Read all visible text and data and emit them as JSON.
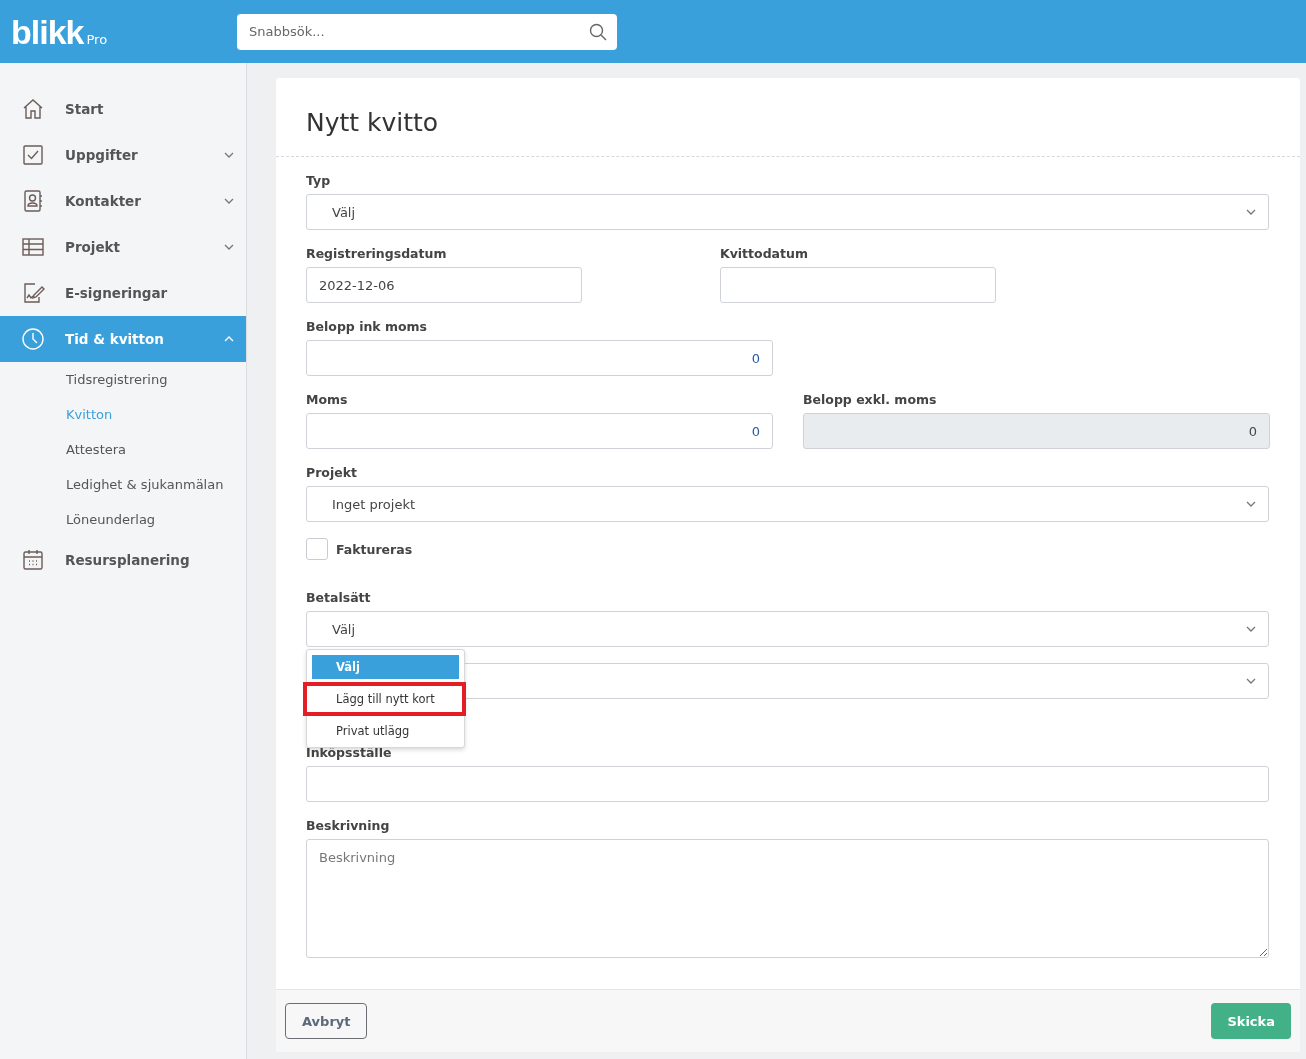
{
  "header": {
    "logo": "blikk",
    "logo_suffix": "Pro",
    "search": {
      "placeholder": "Snabbsök..."
    }
  },
  "sidebar": {
    "items": [
      {
        "label": "Start",
        "selected": false
      },
      {
        "label": "Uppgifter",
        "expanded": false,
        "selected": false
      },
      {
        "label": "Kontakter",
        "expanded": false,
        "selected": false
      },
      {
        "label": "Projekt",
        "expanded": false,
        "selected": false
      },
      {
        "label": "E-signeringar",
        "selected": false
      },
      {
        "label": "Tid & kvitton",
        "expanded": true,
        "selected": true,
        "children": [
          {
            "label": "Tidsregistrering",
            "selected": false
          },
          {
            "label": "Kvitton",
            "selected": true
          },
          {
            "label": "Attestera",
            "selected": false
          },
          {
            "label": "Ledighet & sjukanmälan",
            "selected": false
          },
          {
            "label": "Löneunderlag",
            "selected": false
          }
        ]
      },
      {
        "label": "Resursplanering",
        "selected": false
      }
    ]
  },
  "form": {
    "title": "Nytt kvitto",
    "fields": [
      {
        "kind": "select",
        "label": "Typ",
        "value": "Välj"
      },
      {
        "kind": "pair",
        "items": [
          {
            "label": "Registreringsdatum",
            "value": "2022-12-06"
          },
          {
            "label": "Kvittodatum"
          }
        ]
      },
      {
        "kind": "number",
        "label": "Belopp ink moms",
        "value": "0"
      },
      {
        "kind": "numpair",
        "items": [
          {
            "label": "Moms",
            "value": "0",
            "disabled": false
          },
          {
            "label": "Belopp exkl. moms",
            "value": "0",
            "disabled": true
          }
        ]
      },
      {
        "kind": "select",
        "label": "Projekt",
        "value": "Inget projekt"
      },
      {
        "kind": "checkbox",
        "label": "Faktureras",
        "checked": false
      },
      {
        "kind": "select",
        "label": "Betalsätt",
        "value": "Välj",
        "open": true,
        "options": [
          {
            "label": "Välj",
            "selected": true,
            "highlighted": false
          },
          {
            "label": "Lägg till nytt kort",
            "selected": false,
            "highlighted": true
          },
          {
            "label": "Privat utlägg",
            "selected": false,
            "highlighted": false
          }
        ]
      },
      {
        "kind": "select"
      },
      {
        "kind": "input",
        "label": "Inköpsställe"
      },
      {
        "kind": "textarea",
        "label": "Beskrivning",
        "placeholder": "Beskrivning"
      }
    ],
    "buttons": [
      {
        "label": "Avbryt",
        "kind": "secondary"
      },
      {
        "label": "Skicka",
        "kind": "primary"
      }
    ]
  }
}
